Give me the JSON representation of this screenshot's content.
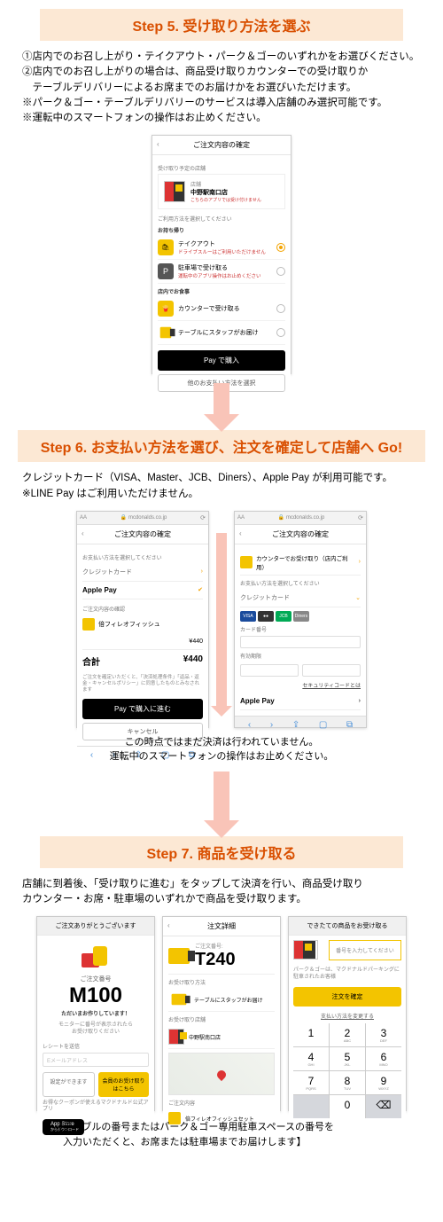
{
  "step5": {
    "title": "Step 5.  受け取り方法を選ぶ",
    "body1": "①店内でのお召し上がり・テイクアウト・パーク＆ゴーのいずれかをお選びください。",
    "body2": "②店内でのお召し上がりの場合は、商品受け取りカウンターでの受け取りか",
    "body3": "　テーブルデリバリーによるお席までのお届けかをお選びいただけます。",
    "body4": "※パーク＆ゴー・テーブルデリバリーのサービスは導入店舗のみ選択可能です。",
    "body5": "※運転中のスマートフォンの操作はお止めください。",
    "phone": {
      "header": "ご注文内容の確定",
      "sectionTop": "受け取り予定の店舗",
      "storeName": "中野駅南口店",
      "storeSub": "店舗",
      "storeNote": "こちらのアプリでは受け付けません",
      "sectionMid": "ご利用方法を選択してください",
      "labelTakeout": "お持ち帰り",
      "opt1": "テイクアウト",
      "opt1sub": "ドライブスルーはご利用いただけません",
      "opt2": "駐車場で受け取る",
      "opt2sub": "運転中のアプリ操作はお止めください",
      "labelEatin": "店内でお食事",
      "opt3": "カウンターで受け取る",
      "opt4": "テーブルにスタッフがお届け",
      "payBtn": " Pay で購入",
      "otherBtn": "他のお支払い方法を選択"
    }
  },
  "step6": {
    "title": "Step 6.  お支払い方法を選び、注文を確定して店舗へ Go!",
    "body1": "クレジットカード（VISA、Master、JCB、Diners）、Apple Pay が利用可能です。",
    "body2": "※LINE Pay はご利用いただけません。",
    "url": "mcdonalds.co.jp",
    "left": {
      "header": "ご注文内容の確定",
      "payNote": "お支払い方法を選択してください",
      "cc": "クレジットカード",
      "applepay": "Apple Pay",
      "secOrder": "ご注文内容の確認",
      "item": "倍フィレオフィッシュ",
      "price": "¥440",
      "totalLbl": "合計",
      "totalVal": "¥440",
      "disclaimer": "ご注文を確定いただくと、「決済処理条件」「返品・返金・キャンセルポリシー」に同意したものとみなされます",
      "blackBtn": "Pay で購入に進む",
      "cancel": "キャンセル"
    },
    "right": {
      "header": "ご注文内容の確定",
      "pickup": "カウンターでお受け取り（店内ご利用）",
      "payNote": "お支払い方法を選択してください",
      "cc": "クレジットカード",
      "v": "VISA",
      "m": "●●",
      "j": "JCB",
      "d": "Diners",
      "numLbl": "カード番号",
      "expLbl": "有効期限",
      "secLink": "セキュリティコードとは",
      "applepay": "Apple Pay"
    },
    "foot1": "この時点ではまだ決済は行われていません。",
    "foot2": "運転中のスマートフォンの操作はお止めください。"
  },
  "step7": {
    "title": "Step 7.  商品を受け取る",
    "body1": "店舗に到着後、「受け取りに進む」をタップして決済を行い、商品受け取り",
    "body2": "カウンター・お席・駐車場のいずれかで商品を受け取ります。",
    "left": {
      "head": "ご注文ありがとうございます",
      "sub": "ご注文番号",
      "num": "M100",
      "msg1": "ただいまお作りしています！",
      "msg2": "モニターに番号が表示されたら",
      "msg3": "お受け取りください",
      "rcpt": "レシートを送信",
      "ph": "Eメールアドレス",
      "btn1": "設定ができます",
      "btn2": "会員のお受け取りはこちら",
      "appNote": "お得なクーポンが使えるマクドナルド公式アプリ",
      "app": "App Store",
      "appSub": "からダウンロード"
    },
    "mid": {
      "head": "注文詳細",
      "sub": "ご注文番号:",
      "num": "T240",
      "method": "お受け取り方法",
      "table": "テーブルにスタッフがお届け",
      "store": "お受け取り店舗",
      "storeName": "中野駅南口店",
      "order": "ご注文内容",
      "item": "倍フィレオフィッシュセット"
    },
    "right": {
      "head": "できたての商品をお受け取る",
      "boxText": "番号を入力してください",
      "note": "パーク＆ゴーは、マクドナルドパーキングに駐車されたお客様",
      "btn": "注文を確定",
      "link": "支払い方法を変更する",
      "k1": "1",
      "k2": "2",
      "k3": "3",
      "k4": "4",
      "k5": "5",
      "k6": "6",
      "k7": "7",
      "k8": "8",
      "k9": "9",
      "k0": "0",
      "s2": "ABC",
      "s3": "DEF",
      "s4": "GHI",
      "s5": "JKL",
      "s6": "MNO",
      "s7": "PQRS",
      "s8": "TUV",
      "s9": "WXYZ"
    },
    "bracket": "【テーブルの番号またはパーク＆ゴー専用駐車スペースの番号を\n　入力いただくと、お席または駐車場までお届けします】"
  }
}
